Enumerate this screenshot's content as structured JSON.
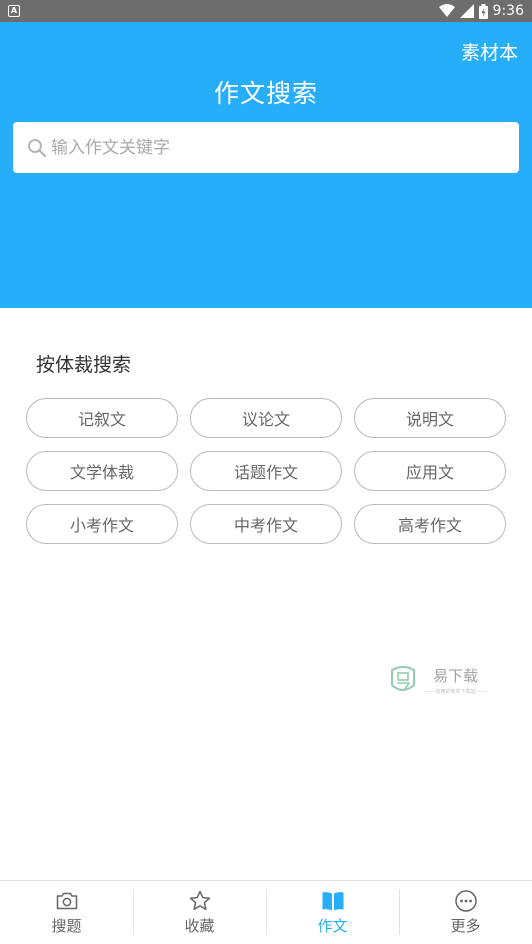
{
  "status_bar": {
    "time": "9:36"
  },
  "header": {
    "material_link": "素材本",
    "title": "作文搜索",
    "search": {
      "placeholder": "输入作文关键字",
      "value": ""
    }
  },
  "genre_section": {
    "title": "按体裁搜索",
    "genres": [
      "记叙文",
      "议论文",
      "说明文",
      "文学体裁",
      "话题作文",
      "应用文",
      "小考作文",
      "中考作文",
      "高考作文"
    ]
  },
  "watermark": {
    "main": "易下载",
    "sub": "—— 好用的软件下载站 ——"
  },
  "tab_bar": {
    "items": [
      {
        "label": "搜题",
        "icon": "camera-icon",
        "active": false
      },
      {
        "label": "收藏",
        "icon": "star-icon",
        "active": false
      },
      {
        "label": "作文",
        "icon": "book-icon",
        "active": true
      },
      {
        "label": "更多",
        "icon": "more-icon",
        "active": false
      }
    ]
  },
  "colors": {
    "accent": "#27aefa",
    "status_bar": "#6d6d6d",
    "button_border": "#b9b9b9"
  }
}
